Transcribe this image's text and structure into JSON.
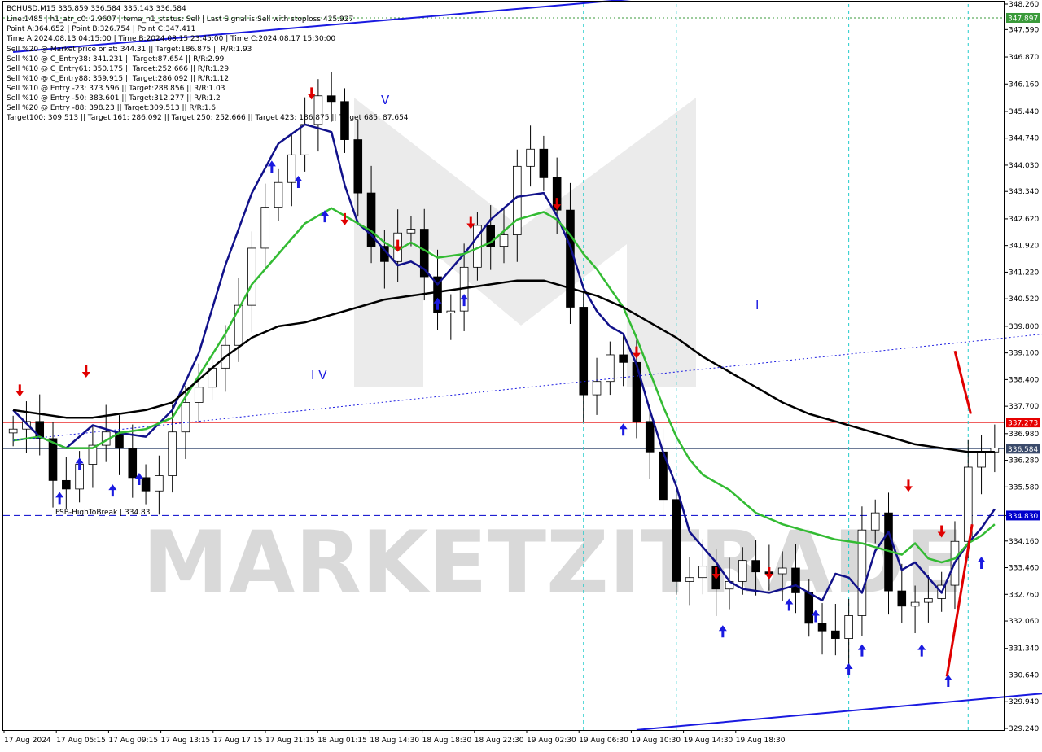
{
  "symbol_header": "BCHUSD,M15  335.859 336.584 335.143 336.584",
  "info_lines": [
    "Line:1485 | h1_atr_c0: 2.9607 | tema_h1_status: Sell | Last Signal is:Sell with stoploss:425.927",
    "Point A:364.652 | Point B:326.754 | Point C:347.411",
    "Time A:2024.08.13 04:15:00 | Time B:2024.08.15 23:45:00 | Time C:2024.08.17 15:30:00",
    "Sell %20 @ Market price or at: 344.31 || Target:186.875 || R/R:1.93",
    "Sell %10 @ C_Entry38: 341.231 || Target:87.654 || R/R:2.99",
    "Sell %10 @ C_Entry61: 350.175 || Target:252.666 || R/R:1.29",
    "Sell %10 @ C_Entry88: 359.915 || Target:286.092 || R/R:1.12",
    "Sell %10 @ Entry -23: 373.596 || Target:288.856 || R/R:1.03",
    "Sell %10 @ Entry -50: 383.601 || Target:312.277 || R/R:1.2",
    "Sell %20 @ Entry -88: 398.23 || Target:309.513 || R/R:1.6",
    "Target100: 309.513 || Target 161: 286.092 || Target 250: 252.666 || Target 423: 186.875 || Target 685: 87.654"
  ],
  "watermark": {
    "text": "MARKETZITRADE",
    "color": "#d8d8d8"
  },
  "wave_labels": [
    "I V",
    "V",
    "I"
  ],
  "fsb_label": "FSB-HighToBreak | 334.83",
  "chart_data": {
    "type": "candlestick",
    "title": "BCHUSD,M15",
    "x_ticks": [
      "17 Aug 2024",
      "17 Aug 05:15",
      "17 Aug 09:15",
      "17 Aug 13:15",
      "17 Aug 17:15",
      "17 Aug 21:15",
      "18 Aug 01:15",
      "18 Aug 14:30",
      "18 Aug 18:30",
      "18 Aug 22:30",
      "19 Aug 02:30",
      "19 Aug 06:30",
      "19 Aug 10:30",
      "19 Aug 14:30",
      "19 Aug 18:30"
    ],
    "y_ticks": [
      "348.260",
      "347.590",
      "346.870",
      "346.160",
      "345.440",
      "344.740",
      "344.030",
      "343.340",
      "342.620",
      "341.920",
      "341.220",
      "340.520",
      "339.800",
      "339.100",
      "338.400",
      "337.700",
      "336.980",
      "336.280",
      "335.580",
      "334.830",
      "334.160",
      "333.460",
      "332.760",
      "332.060",
      "331.340",
      "330.640",
      "329.940",
      "329.240"
    ],
    "ylim": [
      329.24,
      348.26
    ],
    "grid": false,
    "price_levels": [
      {
        "label": "347.897",
        "value": 347.897,
        "color": "#3a9a3a",
        "style": "dotted"
      },
      {
        "label": "337.273",
        "value": 337.273,
        "color": "#e60000",
        "style": "solid"
      },
      {
        "label": "336.584",
        "value": 336.584,
        "color": "#5a6a8a",
        "style": "solid"
      },
      {
        "label": "334.830",
        "value": 334.83,
        "color": "#0000cc",
        "style": "dashed"
      }
    ],
    "close_path": [
      [
        0,
        337.0
      ],
      [
        2,
        337.4
      ],
      [
        4,
        335.2
      ],
      [
        6,
        336.5
      ],
      [
        8,
        337.2
      ],
      [
        9,
        336.0
      ],
      [
        11,
        335.3
      ],
      [
        13,
        337.6
      ],
      [
        15,
        338.4
      ],
      [
        17,
        339.6
      ],
      [
        19,
        342.6
      ],
      [
        21,
        343.9
      ],
      [
        23,
        345.5
      ],
      [
        24,
        346.2
      ],
      [
        25,
        345.2
      ],
      [
        26,
        344.2
      ],
      [
        27,
        342.4
      ],
      [
        28,
        341.4
      ],
      [
        29,
        341.6
      ],
      [
        30,
        342.9
      ],
      [
        31,
        341.8
      ],
      [
        32,
        340.4
      ],
      [
        33,
        339.9
      ],
      [
        34,
        340.5
      ],
      [
        35,
        342.2
      ],
      [
        36,
        342.7
      ],
      [
        37,
        341.1
      ],
      [
        38,
        343.3
      ],
      [
        39,
        344.7
      ],
      [
        40,
        344.2
      ],
      [
        41,
        343.2
      ],
      [
        42,
        342.5
      ],
      [
        43,
        338.1
      ],
      [
        44,
        337.9
      ],
      [
        45,
        338.8
      ],
      [
        46,
        339.3
      ],
      [
        47,
        338.4
      ],
      [
        48,
        336.2
      ],
      [
        49,
        336.8
      ],
      [
        50,
        333.7
      ],
      [
        51,
        332.5
      ],
      [
        52,
        333.9
      ],
      [
        53,
        333.1
      ],
      [
        54,
        332.7
      ],
      [
        55,
        333.5
      ],
      [
        56,
        333.8
      ],
      [
        57,
        332.9
      ],
      [
        58,
        333.7
      ],
      [
        59,
        333.2
      ],
      [
        60,
        332.4
      ],
      [
        61,
        331.6
      ],
      [
        62,
        332.0
      ],
      [
        63,
        331.2
      ],
      [
        64,
        333.2
      ],
      [
        65,
        335.7
      ],
      [
        66,
        334.1
      ],
      [
        67,
        331.6
      ],
      [
        68,
        333.3
      ],
      [
        69,
        331.8
      ],
      [
        70,
        333.5
      ],
      [
        71,
        332.5
      ],
      [
        72,
        335.8
      ],
      [
        73,
        336.4
      ],
      [
        74,
        336.6
      ]
    ],
    "series": [
      {
        "type": "line",
        "color": "#11118a",
        "points": [
          [
            0,
            337.6
          ],
          [
            2,
            336.9
          ],
          [
            4,
            336.6
          ],
          [
            6,
            337.2
          ],
          [
            8,
            337.0
          ],
          [
            10,
            336.9
          ],
          [
            12,
            337.6
          ],
          [
            14,
            339.1
          ],
          [
            16,
            341.4
          ],
          [
            18,
            343.3
          ],
          [
            20,
            344.6
          ],
          [
            22,
            345.1
          ],
          [
            24,
            344.9
          ],
          [
            25,
            343.5
          ],
          [
            26,
            342.5
          ],
          [
            27,
            342.2
          ],
          [
            28,
            341.8
          ],
          [
            29,
            341.4
          ],
          [
            30,
            341.5
          ],
          [
            31,
            341.3
          ],
          [
            32,
            340.9
          ],
          [
            33,
            341.3
          ],
          [
            34,
            341.7
          ],
          [
            36,
            342.6
          ],
          [
            38,
            343.2
          ],
          [
            40,
            343.3
          ],
          [
            41,
            342.7
          ],
          [
            42,
            341.9
          ],
          [
            43,
            340.8
          ],
          [
            44,
            340.2
          ],
          [
            45,
            339.8
          ],
          [
            46,
            339.6
          ],
          [
            47,
            338.8
          ],
          [
            48,
            337.6
          ],
          [
            49,
            336.5
          ],
          [
            50,
            335.6
          ],
          [
            51,
            334.4
          ],
          [
            52,
            334.0
          ],
          [
            53,
            333.6
          ],
          [
            54,
            333.1
          ],
          [
            55,
            332.9
          ],
          [
            57,
            332.8
          ],
          [
            59,
            333.0
          ],
          [
            61,
            332.6
          ],
          [
            62,
            333.3
          ],
          [
            63,
            333.2
          ],
          [
            64,
            332.8
          ],
          [
            65,
            333.9
          ],
          [
            66,
            334.4
          ],
          [
            67,
            333.4
          ],
          [
            68,
            333.6
          ],
          [
            69,
            333.2
          ],
          [
            70,
            332.8
          ],
          [
            71,
            333.6
          ],
          [
            72,
            334.1
          ],
          [
            73,
            334.5
          ],
          [
            74,
            335.0
          ]
        ]
      },
      {
        "type": "line",
        "color": "#33bb33",
        "points": [
          [
            0,
            336.8
          ],
          [
            2,
            336.9
          ],
          [
            4,
            336.6
          ],
          [
            6,
            336.6
          ],
          [
            8,
            337.0
          ],
          [
            10,
            337.1
          ],
          [
            12,
            337.4
          ],
          [
            14,
            338.5
          ],
          [
            16,
            339.6
          ],
          [
            18,
            340.9
          ],
          [
            20,
            341.7
          ],
          [
            22,
            342.5
          ],
          [
            24,
            342.9
          ],
          [
            26,
            342.5
          ],
          [
            27,
            342.3
          ],
          [
            28,
            342.0
          ],
          [
            29,
            341.8
          ],
          [
            30,
            342.0
          ],
          [
            32,
            341.6
          ],
          [
            34,
            341.7
          ],
          [
            36,
            342.0
          ],
          [
            38,
            342.6
          ],
          [
            40,
            342.8
          ],
          [
            41,
            342.6
          ],
          [
            42,
            342.2
          ],
          [
            43,
            341.7
          ],
          [
            44,
            341.3
          ],
          [
            45,
            340.8
          ],
          [
            46,
            340.3
          ],
          [
            47,
            339.5
          ],
          [
            48,
            338.6
          ],
          [
            49,
            337.7
          ],
          [
            50,
            336.9
          ],
          [
            51,
            336.3
          ],
          [
            52,
            335.9
          ],
          [
            54,
            335.5
          ],
          [
            56,
            334.9
          ],
          [
            58,
            334.6
          ],
          [
            60,
            334.4
          ],
          [
            62,
            334.2
          ],
          [
            64,
            334.1
          ],
          [
            65,
            334.0
          ],
          [
            66,
            333.9
          ],
          [
            67,
            333.8
          ],
          [
            68,
            334.1
          ],
          [
            69,
            333.7
          ],
          [
            70,
            333.6
          ],
          [
            71,
            333.7
          ],
          [
            72,
            334.1
          ],
          [
            73,
            334.3
          ],
          [
            74,
            334.6
          ]
        ]
      },
      {
        "type": "line",
        "color": "#000000",
        "points": [
          [
            0,
            337.6
          ],
          [
            2,
            337.5
          ],
          [
            4,
            337.4
          ],
          [
            6,
            337.4
          ],
          [
            8,
            337.5
          ],
          [
            10,
            337.6
          ],
          [
            12,
            337.8
          ],
          [
            14,
            338.4
          ],
          [
            16,
            339.0
          ],
          [
            18,
            339.5
          ],
          [
            20,
            339.8
          ],
          [
            22,
            339.9
          ],
          [
            24,
            340.1
          ],
          [
            26,
            340.3
          ],
          [
            28,
            340.5
          ],
          [
            30,
            340.6
          ],
          [
            32,
            340.7
          ],
          [
            34,
            340.8
          ],
          [
            36,
            340.9
          ],
          [
            38,
            341.0
          ],
          [
            40,
            341.0
          ],
          [
            42,
            340.8
          ],
          [
            44,
            340.6
          ],
          [
            46,
            340.3
          ],
          [
            48,
            339.9
          ],
          [
            50,
            339.5
          ],
          [
            52,
            339.0
          ],
          [
            54,
            338.6
          ],
          [
            56,
            338.2
          ],
          [
            58,
            337.8
          ],
          [
            60,
            337.5
          ],
          [
            62,
            337.3
          ],
          [
            64,
            337.1
          ],
          [
            66,
            336.9
          ],
          [
            68,
            336.7
          ],
          [
            70,
            336.6
          ],
          [
            72,
            336.5
          ],
          [
            74,
            336.5
          ]
        ]
      }
    ],
    "trend_lines": [
      {
        "color": "#1a1ae0",
        "width": 2,
        "dash": "",
        "points": [
          [
            0,
            347.0
          ],
          [
            47,
            348.4
          ]
        ]
      },
      {
        "color": "#1a1ae0",
        "width": 2,
        "dash": "",
        "points": [
          [
            47,
            329.2
          ],
          [
            95,
            330.7
          ]
        ]
      },
      {
        "color": "#1a1ae0",
        "width": 1,
        "dash": "2,3",
        "points": [
          [
            0,
            336.8
          ],
          [
            100,
            340.4
          ]
        ]
      },
      {
        "color": "#e00000",
        "width": 3,
        "dash": "",
        "points": [
          [
            71,
            339.15
          ],
          [
            72.2,
            337.5
          ]
        ]
      },
      {
        "color": "#e00000",
        "width": 3,
        "dash": "",
        "points": [
          [
            70.4,
            330.6
          ],
          [
            72.3,
            334.6
          ]
        ]
      }
    ],
    "vertical_markers": [
      43,
      50,
      63,
      72
    ],
    "sell_arrows": [
      [
        0.5,
        338.1
      ],
      [
        5.5,
        338.6
      ],
      [
        22.5,
        345.9
      ],
      [
        25,
        342.6
      ],
      [
        29,
        341.9
      ],
      [
        34.5,
        342.5
      ],
      [
        41,
        343.0
      ],
      [
        47,
        339.1
      ],
      [
        53,
        333.3
      ],
      [
        57,
        333.3
      ],
      [
        67.5,
        335.6
      ],
      [
        70,
        334.4
      ]
    ],
    "buy_arrows": [
      [
        3.5,
        335.3
      ],
      [
        5,
        336.2
      ],
      [
        7.5,
        335.5
      ],
      [
        9.5,
        335.8
      ],
      [
        19.5,
        344.0
      ],
      [
        21.5,
        343.6
      ],
      [
        23.5,
        342.7
      ],
      [
        32,
        340.4
      ],
      [
        34,
        340.5
      ],
      [
        46,
        337.1
      ],
      [
        53.5,
        331.8
      ],
      [
        58.5,
        332.5
      ],
      [
        60.5,
        332.2
      ],
      [
        63,
        330.8
      ],
      [
        64,
        331.3
      ],
      [
        68.5,
        331.3
      ],
      [
        70.5,
        330.5
      ],
      [
        73,
        333.6
      ]
    ]
  }
}
